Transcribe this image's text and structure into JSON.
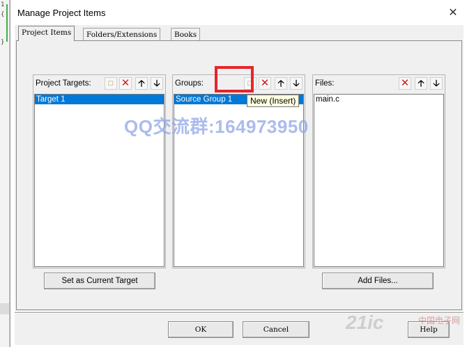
{
  "editor_background": {
    "line_numbers": [
      "1",
      "{",
      "}"
    ]
  },
  "dialog": {
    "title": "Manage Project Items",
    "close_glyph": "✕",
    "tabs": [
      {
        "label": "Project Items",
        "active": true
      },
      {
        "label": "Folders/Extensions",
        "active": false
      },
      {
        "label": "Books",
        "active": false
      }
    ],
    "project_targets": {
      "label": "Project Targets:",
      "items": [
        {
          "name": "Target 1",
          "selected": true
        }
      ],
      "button": "Set as Current Target"
    },
    "groups": {
      "label": "Groups:",
      "items": [
        {
          "name": "Source Group 1",
          "selected": true
        }
      ]
    },
    "files": {
      "label": "Files:",
      "items": [
        {
          "name": "main.c",
          "selected": false
        }
      ],
      "button": "Add Files..."
    },
    "tooltip": "New (Insert)",
    "watermark": "QQ交流群:164973950",
    "ok_label": "OK",
    "cancel_label": "Cancel",
    "help_label": "Help",
    "logo_text": "21ic",
    "logo_sub": "中国电子网"
  },
  "icons": {
    "new": "new-icon",
    "delete": "delete-icon",
    "up": "move-up-icon",
    "down": "move-down-icon"
  },
  "colors": {
    "selection": "#0078d7",
    "highlight_box": "#e8232a",
    "tooltip_bg": "#ffffe1"
  }
}
